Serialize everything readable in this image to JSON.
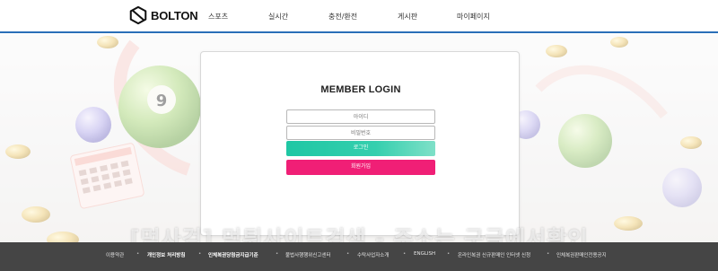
{
  "brand": {
    "name": "BOLTON",
    "logo_icon": "bolton-cube-logo",
    "accent_color": "#2a6fb8"
  },
  "nav": {
    "items": [
      "스포츠",
      "실시간",
      "충전/환전",
      "게시판",
      "마이페이지"
    ]
  },
  "login": {
    "title": "MEMBER LOGIN",
    "id_placeholder": "아이디",
    "password_placeholder": "비밀번호",
    "login_label": "로그인",
    "join_label": "회원가입",
    "login_color": "#1fc7a4",
    "join_color": "#f01f76"
  },
  "watermark": {
    "text": "[먹사검] 먹튀사이트검색 - 주소는 구글에서확인"
  },
  "footer": {
    "links": [
      {
        "label": "이용약관",
        "bold": false
      },
      {
        "label": "개인정보 처리방침",
        "bold": true
      },
      {
        "label": "인체복권당첨금지급기준",
        "bold": true
      },
      {
        "label": "불법사행행위신고센터",
        "bold": false
      },
      {
        "label": "수탁사업자소개",
        "bold": false
      },
      {
        "label": "ENGLISH",
        "bold": false
      },
      {
        "label": "온라인복권 신규판매인 인터넷 신청",
        "bold": false
      },
      {
        "label": "인체복권판매인전용공지",
        "bold": false
      }
    ],
    "background": "#454545"
  }
}
